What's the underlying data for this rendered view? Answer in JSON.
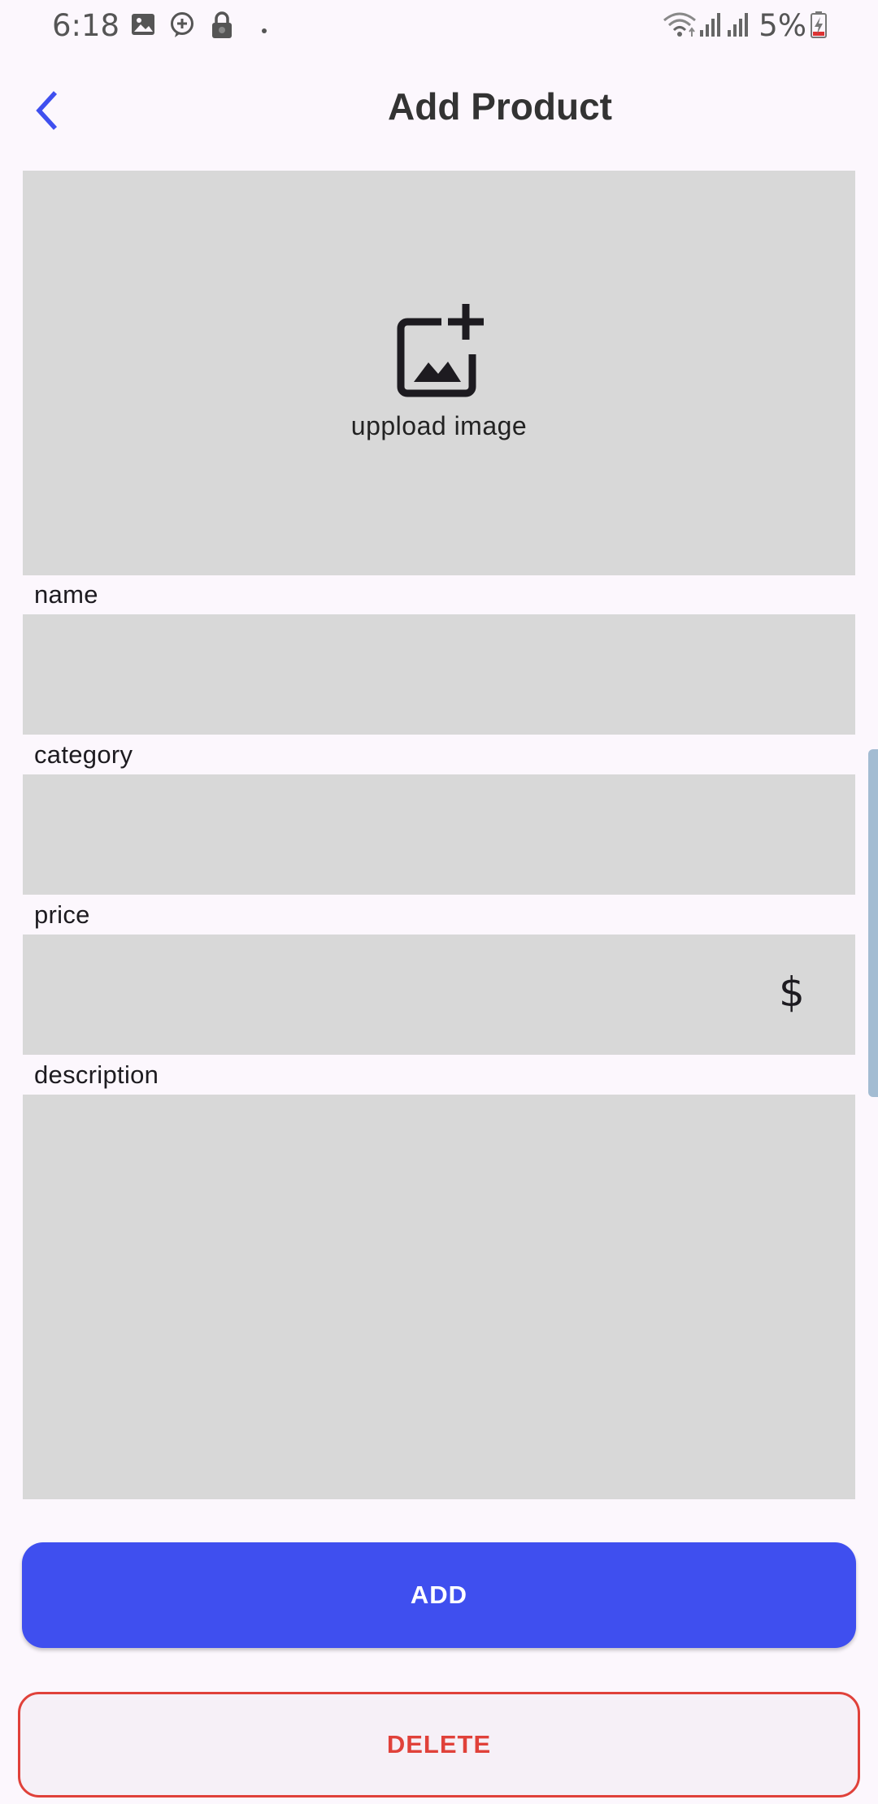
{
  "status_bar": {
    "time": "6:18",
    "battery_percent": "5%",
    "left_icons": [
      "image-icon",
      "messenger-icon",
      "lock-icon",
      "dot-icon"
    ],
    "right_icons": [
      "wifi-icon",
      "signal-icon",
      "signal-icon",
      "battery-charging-icon"
    ]
  },
  "app_bar": {
    "title": "Add Product",
    "back_icon": "chevron-left-icon"
  },
  "image_upload": {
    "icon": "add-photo-icon",
    "label": "uppload image"
  },
  "fields": {
    "name": {
      "label": "name",
      "value": ""
    },
    "category": {
      "label": "category",
      "value": ""
    },
    "price": {
      "label": "price",
      "value": "",
      "suffix": "$"
    },
    "description": {
      "label": "description",
      "value": ""
    }
  },
  "buttons": {
    "add": "ADD",
    "delete": "DELETE"
  },
  "colors": {
    "background": "#fcf7fd",
    "field_fill": "#d8d8d8",
    "primary": "#3f4fef",
    "danger": "#e0413a",
    "back_arrow": "#3f4fef"
  }
}
